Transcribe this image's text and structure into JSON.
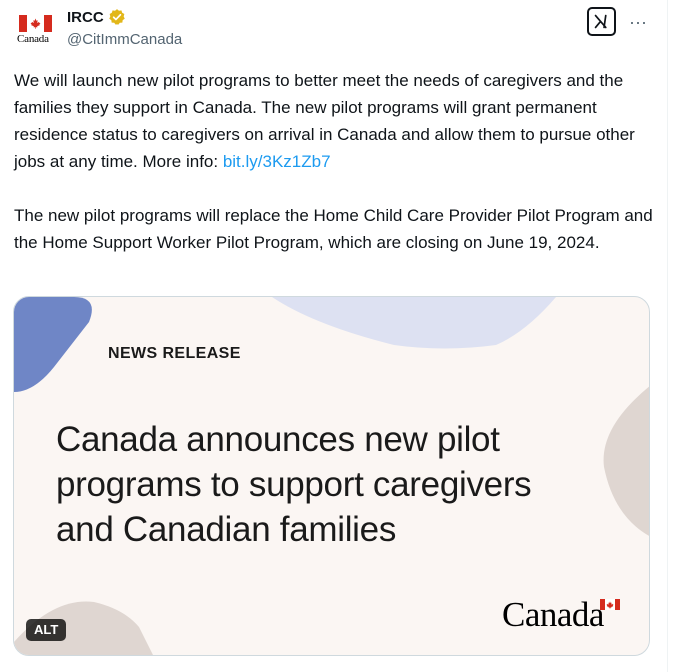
{
  "author": {
    "display_name": "IRCC",
    "handle": "@CitImmCanada",
    "avatar_wordmark": "Canada",
    "verified_color": "#e2b719"
  },
  "header": {
    "more_label": "···"
  },
  "tweet": {
    "paragraph1_text": "We will launch new pilot programs to better meet the needs of caregivers and the families they support in Canada. The new pilot programs will grant permanent residence status to caregivers on arrival in Canada and allow them to pursue other jobs at any time. More info: ",
    "link_text": "bit.ly/3Kz1Zb7",
    "paragraph2_text": "The new pilot programs will replace the Home Child Care Provider Pilot Program and the Home Support Worker Pilot Program, which are closing on June 19, 2024."
  },
  "media": {
    "kicker": "NEWS RELEASE",
    "headline_lines": [
      "Canada announces new pilot",
      "programs to support caregivers",
      "and Canadian families"
    ],
    "wordmark": "Canada",
    "alt_label": "ALT"
  },
  "colors": {
    "link": "#1d9bf0",
    "flag_red": "#d52b1e",
    "media_bg": "#fbf6f3",
    "shape_blue": "#6f86c6",
    "shape_lavender": "#dde1f2",
    "shape_taupe": "#dfd6d1"
  }
}
